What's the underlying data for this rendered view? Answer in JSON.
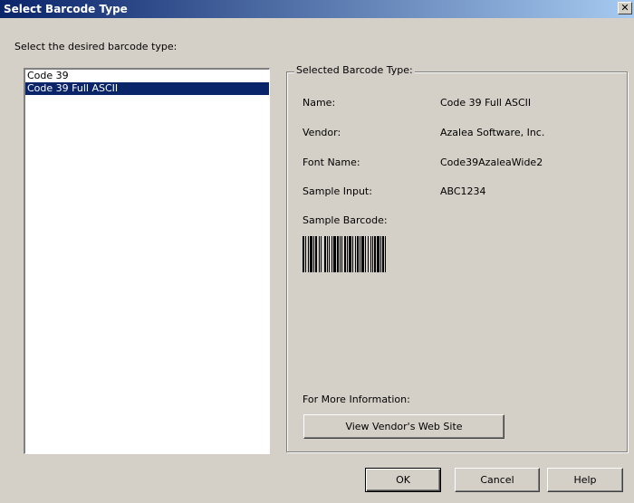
{
  "window": {
    "title": "Select Barcode Type",
    "close_glyph": "✕"
  },
  "prompt": "Select the desired barcode type:",
  "list": {
    "items": [
      "Code 39",
      "Code 39 Full ASCII"
    ],
    "selected_index": 1
  },
  "group": {
    "legend": "Selected Barcode Type:",
    "name_label": "Name:",
    "name_value": "Code 39 Full ASCII",
    "vendor_label": "Vendor:",
    "vendor_value": "Azalea Software, Inc.",
    "font_label": "Font Name:",
    "font_value": "Code39AzaleaWide2",
    "sample_input_label": "Sample Input:",
    "sample_input_value": "ABC1234",
    "sample_barcode_label": "Sample Barcode:",
    "more_info_label": "For More Information:",
    "vendor_button": "View Vendor's Web Site"
  },
  "buttons": {
    "ok": "OK",
    "cancel": "Cancel",
    "help": "Help"
  },
  "colors": {
    "title_bar_start": "#0a246a",
    "title_bar_end": "#a6caf0",
    "selection": "#0a246a",
    "dialog_face": "#d4d0c8"
  }
}
